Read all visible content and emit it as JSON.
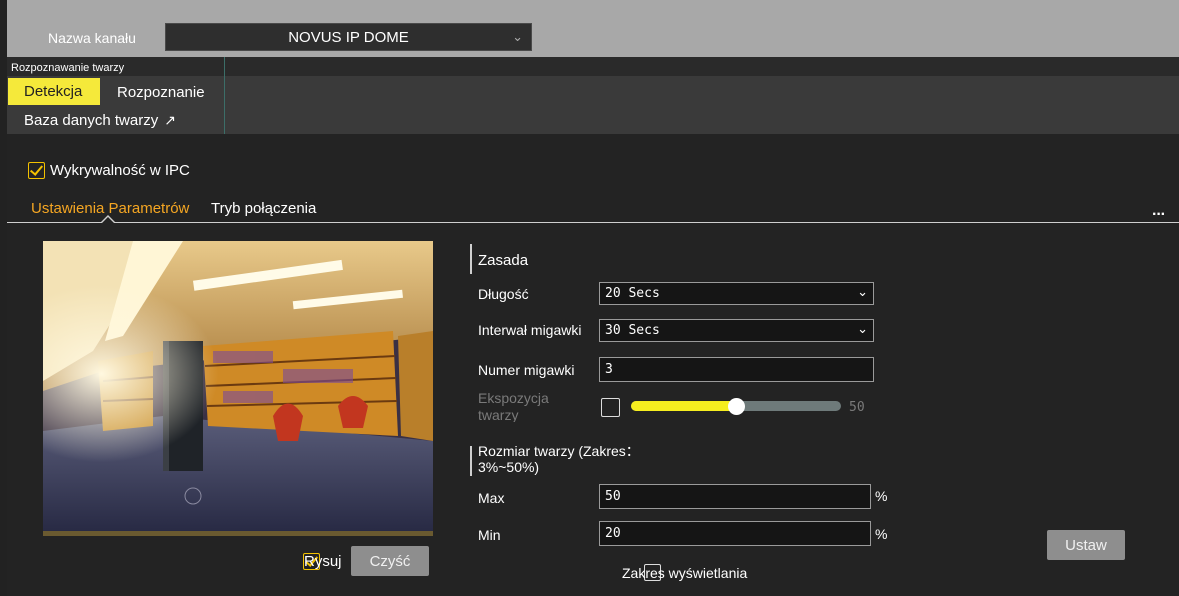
{
  "channel": {
    "label": "Nazwa kanału",
    "selected": "NOVUS IP DOME"
  },
  "face_recognition": {
    "title": "Rozpoznawanie twarzy",
    "tabs": [
      "Detekcja",
      "Rozpoznanie"
    ],
    "active_tab": "Detekcja",
    "database_link": "Baza danych twarzy",
    "accent": "#f5e93a"
  },
  "ipc_detection": {
    "label": "Wykrywalność w IPC",
    "checked": true
  },
  "sub_tabs": {
    "params": "Ustawienia Parametrów",
    "connection": "Tryb połączenia",
    "active": "params",
    "active_color": "#f5a623"
  },
  "preview": {
    "draw_label": "Rysuj",
    "draw_checked": true,
    "clear_button": "Czyść"
  },
  "rule": {
    "title": "Zasada",
    "duration": {
      "label": "Długość",
      "value": "20 Secs"
    },
    "snapshot_interval": {
      "label": "Interwał migawki",
      "value": "30 Secs"
    },
    "snapshot_number": {
      "label": "Numer migawki",
      "value": "3"
    },
    "face_exposure": {
      "label": "Ekspozycja twarzy",
      "checked": false,
      "value": "50",
      "level_percent": 50
    }
  },
  "face_size": {
    "title": "Rozmiar twarzy (Zakres：3%~50%)",
    "max": {
      "label": "Max",
      "value": "50",
      "unit": "%"
    },
    "min": {
      "label": "Min",
      "value": "20",
      "unit": "%"
    },
    "display_range": {
      "label": "Zakres wyświetlania",
      "checked": false
    }
  },
  "actions": {
    "set_button": "Ustaw"
  }
}
